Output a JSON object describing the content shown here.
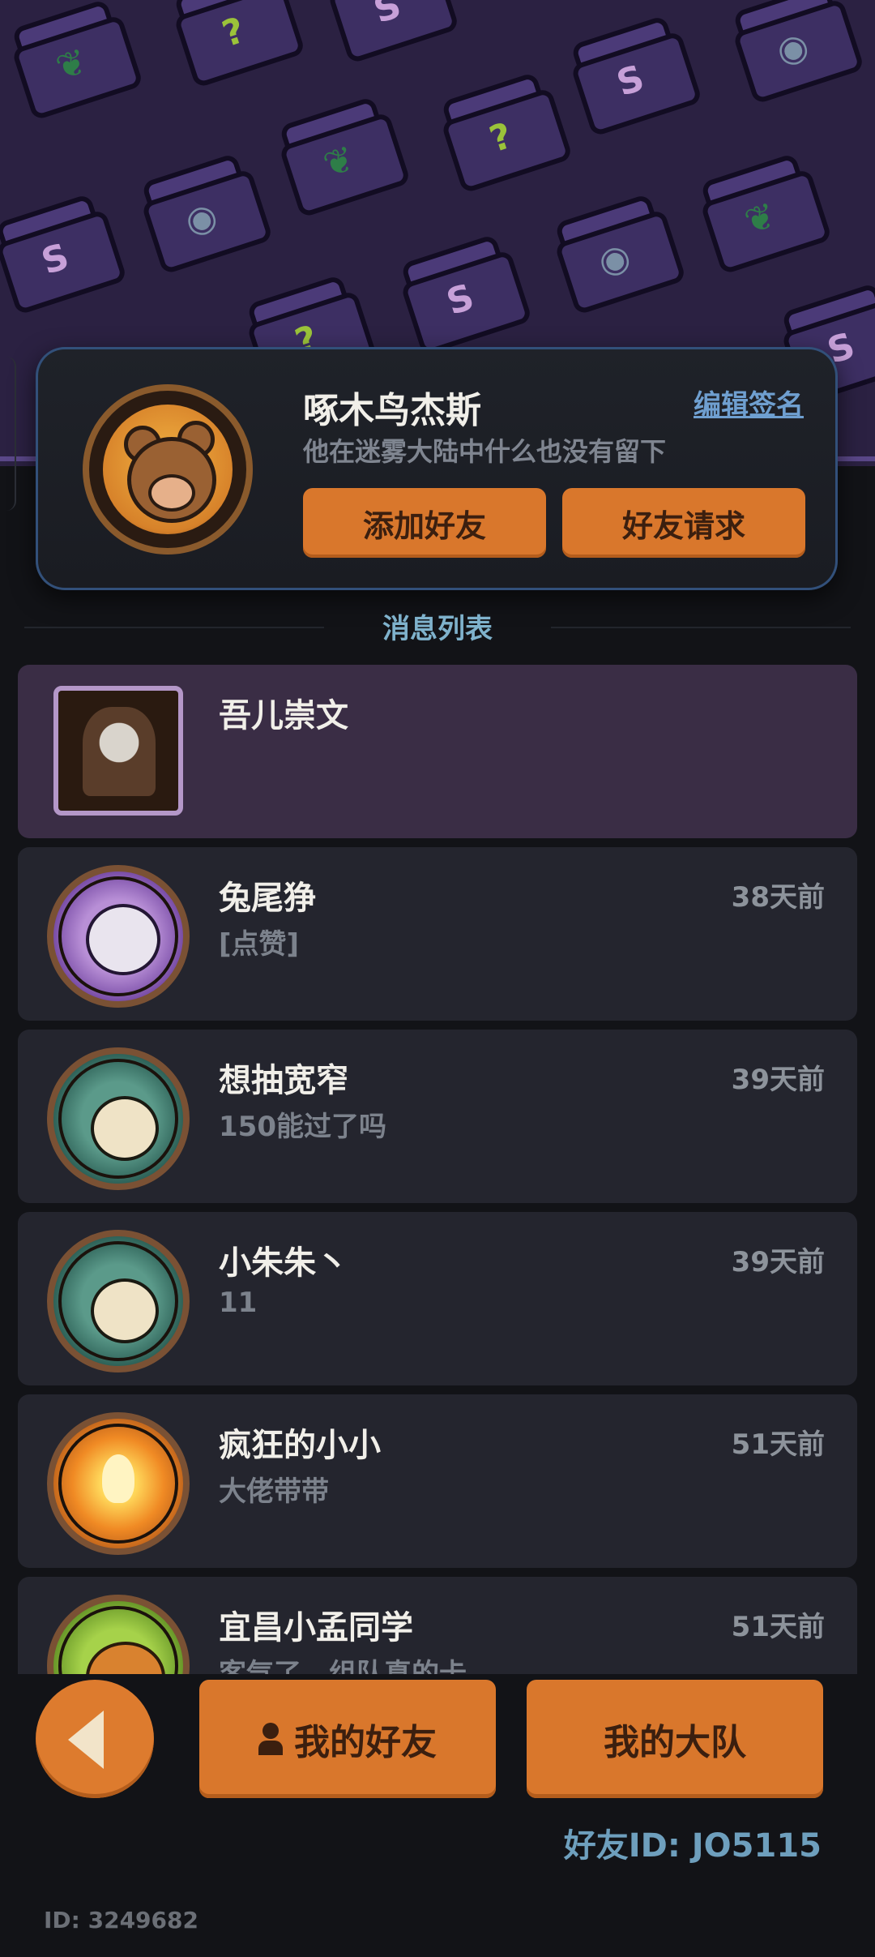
{
  "profile": {
    "name": "啄木鸟杰斯",
    "edit_signature": "编辑签名",
    "signature": "他在迷雾大陆中什么也没有留下",
    "add_friend": "添加好友",
    "friend_requests": "好友请求",
    "avatar_icon": "bear-avatar-icon"
  },
  "section_title": "消息列表",
  "messages": [
    {
      "name": "吾儿崇文",
      "text": "",
      "time": "",
      "avatar": "knight-avatar-icon",
      "highlight": true
    },
    {
      "name": "兔尾狰",
      "text": "[点赞]",
      "time": "38天前",
      "avatar": "sheep-avatar-icon"
    },
    {
      "name": "想抽宽窄",
      "text": "150能过了吗",
      "time": "39天前",
      "avatar": "deer-avatar-icon"
    },
    {
      "name": "小朱朱丶",
      "text": "11",
      "time": "39天前",
      "avatar": "deer-avatar-icon"
    },
    {
      "name": "疯狂的小小",
      "text": "大佬带带",
      "time": "51天前",
      "avatar": "campfire-avatar-icon"
    },
    {
      "name": "宜昌小孟同学",
      "text": "客气了，组队真的卡",
      "time": "51天前",
      "avatar": "fox-avatar-icon"
    }
  ],
  "bottom": {
    "my_friends": "我的好友",
    "my_team": "我的大队",
    "friend_id": "好友ID: JO5115",
    "user_id": "ID: 3249682"
  },
  "colors": {
    "accent_orange": "#d9772c",
    "banner": "#2b2142",
    "background": "#121317",
    "link_blue": "#6f9fd0"
  }
}
